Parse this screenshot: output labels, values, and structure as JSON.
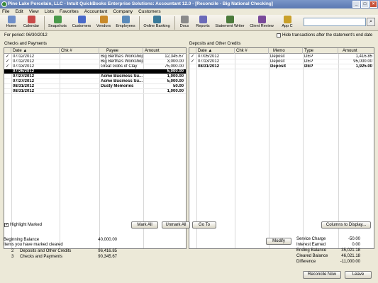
{
  "window": {
    "title": "Pine Lake Porcelain, LLC  - Intuit QuickBooks Enterprise Solutions: Accountant 12.0 - [Reconcile - Big National Checking]",
    "minimize": "_",
    "restore": "□",
    "close": "×"
  },
  "menu": [
    "File",
    "Edit",
    "View",
    "Lists",
    "Favorites",
    "Accountant",
    "Company",
    "Customers"
  ],
  "toolbar": {
    "items": [
      {
        "label": "Home",
        "color": "#6f8fc9"
      },
      {
        "label": "Calendar",
        "color": "#c94a4a"
      },
      {
        "label": "Snapshots",
        "color": "#4a9a4a"
      },
      {
        "label": "Customers",
        "color": "#4a6ac9"
      },
      {
        "label": "Vendors",
        "color": "#c98a2a"
      },
      {
        "label": "Employees",
        "color": "#5a8aba"
      },
      {
        "label": "Online Banking",
        "color": "#3a7a9a"
      },
      {
        "label": "Docs",
        "color": "#8a8a8a"
      },
      {
        "label": "Reports",
        "color": "#6a6ab9"
      },
      {
        "label": "Statement Writer",
        "color": "#4a7a3a"
      },
      {
        "label": "Client Review",
        "color": "#7a4a9a"
      },
      {
        "label": "App C",
        "color": "#c9a02a"
      }
    ],
    "search_go": "⌕"
  },
  "period": "For period: 06/30/2012",
  "hide_transactions": "Hide transactions after the statement's end date",
  "checks": {
    "section_label": "Checks and Payments",
    "columns": [
      "",
      "Date",
      "Chk #",
      "Payee",
      "Amount"
    ],
    "sort_arrow": "▲",
    "rows": [
      {
        "check": "✓",
        "date": "07/12/2012",
        "chk": "",
        "payee": "Big Bertha's Workshop",
        "amount": "12,345.67",
        "bold": false,
        "selected": false
      },
      {
        "check": "✓",
        "date": "07/12/2012",
        "chk": "",
        "payee": "Big Bertha's Workshop",
        "amount": "3,000.00",
        "bold": false,
        "selected": false
      },
      {
        "check": "✓",
        "date": "07/13/2012",
        "chk": "",
        "payee": "Great Gobs of Clay",
        "amount": "75,000.00",
        "bold": false,
        "selected": false
      },
      {
        "check": "",
        "date": "07/26/2012",
        "chk": "",
        "payee": "",
        "amount": "5,000.00",
        "bold": true,
        "selected": true
      },
      {
        "check": "",
        "date": "07/27/2012",
        "chk": "",
        "payee": "Acme Business Su...",
        "amount": "1,000.00",
        "bold": true,
        "selected": false
      },
      {
        "check": "",
        "date": "07/27/2012",
        "chk": "",
        "payee": "Acme Business Su...",
        "amount": "5,000.00",
        "bold": true,
        "selected": false
      },
      {
        "check": "",
        "date": "08/31/2012",
        "chk": "",
        "payee": "Dusty Memories",
        "amount": "50.00",
        "bold": true,
        "selected": false
      },
      {
        "check": "",
        "date": "08/31/2012",
        "chk": "",
        "payee": "",
        "amount": "1,000.00",
        "bold": true,
        "selected": false
      }
    ]
  },
  "deposits": {
    "section_label": "Deposits and Other Credits",
    "columns": [
      "",
      "Date",
      "Chk #",
      "Memo",
      "Type",
      "Amount"
    ],
    "sort_arrow": "▲",
    "rows": [
      {
        "check": "✓",
        "date": "07/05/2012",
        "chk": "",
        "memo": "Deposit",
        "type": "DEP",
        "amount": "1,416.85",
        "bold": false
      },
      {
        "check": "✓",
        "date": "07/13/2012",
        "chk": "",
        "memo": "Deposit",
        "type": "DEP",
        "amount": "95,000.00",
        "bold": false
      },
      {
        "check": "",
        "date": "08/31/2012",
        "chk": "",
        "memo": "Deposit",
        "type": "DEP",
        "amount": "1,925.00",
        "bold": true
      }
    ]
  },
  "highlight_marked": {
    "label": "Highlight Marked",
    "checked": "✓"
  },
  "buttons": {
    "mark_all": "Mark All",
    "unmark_all": "Unmark All",
    "go_to": "Go To",
    "columns_to_display": "Columns to Display...",
    "modify": "Modify",
    "reconcile_now": "Reconcile Now",
    "leave": "Leave"
  },
  "summary": {
    "beginning_balance_label": "Beginning Balance",
    "beginning_balance": "40,000.00",
    "items_cleared_label": "Items you have marked cleared",
    "deposits_count": "2",
    "deposits_label": "Deposits and Other Credits",
    "deposits_total": "96,416.85",
    "checks_count": "3",
    "checks_label": "Checks and Payments",
    "checks_total": "90,345.67"
  },
  "balances": [
    {
      "label": "Service Charge",
      "value": "-50.00"
    },
    {
      "label": "Interest Earned",
      "value": "0.00"
    },
    {
      "label": "Ending Balance",
      "value": "35,021.18"
    },
    {
      "label": "Cleared Balance",
      "value": "46,021.18"
    },
    {
      "label": "Difference",
      "value": "-11,000.00"
    }
  ]
}
